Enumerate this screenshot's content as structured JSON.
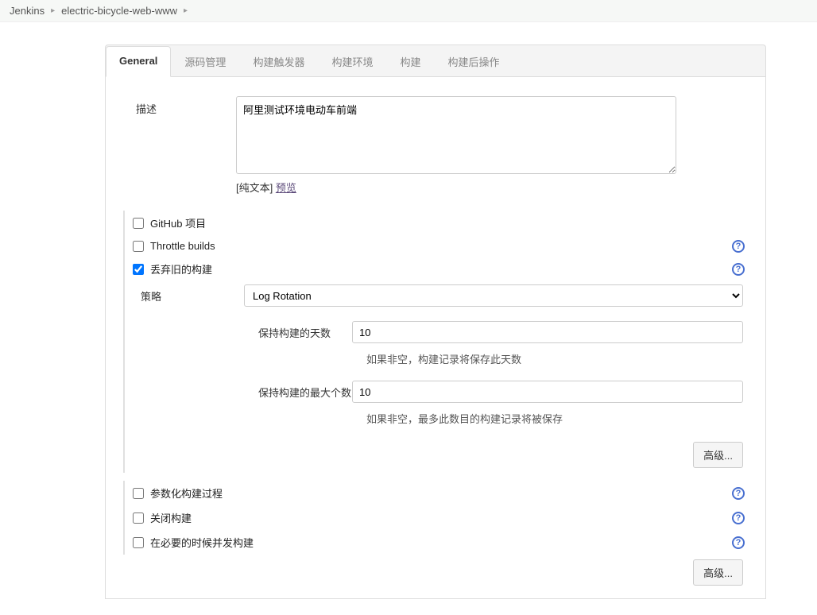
{
  "breadcrumb": {
    "jenkins": "Jenkins",
    "project": "electric-bicycle-web-www"
  },
  "tabs": {
    "general": "General",
    "scm": "源码管理",
    "triggers": "构建触发器",
    "env": "构建环境",
    "build": "构建",
    "post": "构建后操作"
  },
  "form": {
    "description_label": "描述",
    "description_value": "阿里测试环境电动车前端",
    "plaintext_prefix": "[纯文本] ",
    "preview_link": "预览",
    "github_project": "GitHub 项目",
    "throttle_builds": "Throttle builds",
    "discard_old": "丢弃旧的构建",
    "strategy_label": "策略",
    "strategy_value": "Log Rotation",
    "days_keep_label": "保持构建的天数",
    "days_keep_value": "10",
    "days_keep_hint": "如果非空，构建记录将保存此天数",
    "max_keep_label": "保持构建的最大个数",
    "max_keep_value": "10",
    "max_keep_hint": "如果非空，最多此数目的构建记录将被保存",
    "advanced": "高级...",
    "parameterized": "参数化构建过程",
    "disable_build": "关闭构建",
    "concurrent_build": "在必要的时候并发构建"
  }
}
